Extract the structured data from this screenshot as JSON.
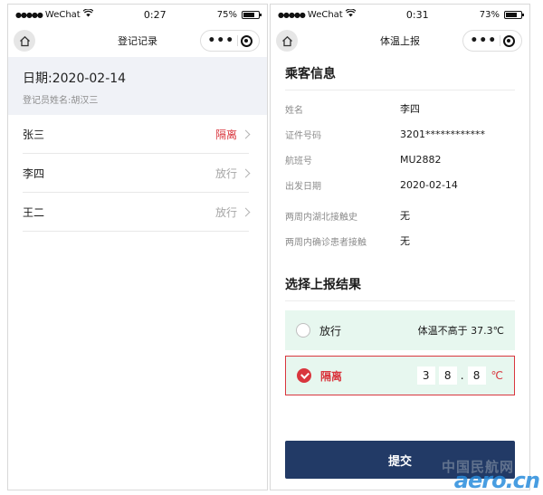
{
  "left": {
    "status_bar": {
      "carrier": "WeChat",
      "time": "0:27",
      "battery": "75%",
      "battery_level": 0.75
    },
    "nav": {
      "title": "登记记录"
    },
    "header": {
      "date": "日期:2020-02-14",
      "registrar": "登记员姓名:胡汉三"
    },
    "passengers": [
      {
        "name": "张三",
        "status": "隔离",
        "status_color": "#d9363e"
      },
      {
        "name": "李四",
        "status": "放行",
        "status_color": "#a6a6a6"
      },
      {
        "name": "王二",
        "status": "放行",
        "status_color": "#a6a6a6"
      }
    ]
  },
  "right": {
    "status_bar": {
      "carrier": "WeChat",
      "time": "0:31",
      "battery": "73%",
      "battery_level": 0.73
    },
    "nav": {
      "title": "体温上报"
    },
    "passenger_info": {
      "title": "乘客信息",
      "fields": [
        {
          "label": "姓名",
          "value": "李四"
        },
        {
          "label": "证件号码",
          "value": "3201************"
        },
        {
          "label": "航班号",
          "value": "MU2882"
        },
        {
          "label": "出发日期",
          "value": "2020-02-14"
        },
        {
          "label": "两周内湖北接触史",
          "value": "无"
        },
        {
          "label": "两周内确诊患者接触",
          "value": "无"
        }
      ]
    },
    "result": {
      "title": "选择上报结果",
      "release": {
        "label": "放行",
        "note": "体温不高于 37.3℃",
        "checked": false
      },
      "isolate": {
        "label": "隔离",
        "digits": [
          "3",
          "8",
          "8"
        ],
        "dot": ".",
        "unit": "℃",
        "checked": true
      }
    },
    "submit_label": "提交"
  },
  "watermark": {
    "cn": "中国民航网",
    "en": "aero.cn"
  },
  "colors": {
    "accent_red": "#d9363e",
    "submit_bg": "#223a66",
    "option_bg": "#e7f7ef",
    "header_bg": "#f0f2f7"
  }
}
